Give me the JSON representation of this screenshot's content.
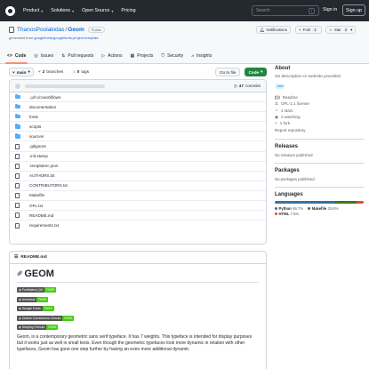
{
  "nav": {
    "items": [
      "Product",
      "Solutions",
      "Open Source",
      "Pricing"
    ],
    "search_placeholder": "Search",
    "search_key": "/",
    "signin": "Sign in",
    "signup": "Sign up"
  },
  "repo": {
    "owner": "ThanosPoulakidas",
    "name": "Geom",
    "visibility": "Public",
    "generated_prefix": "generated from",
    "generated_link": "googlefonts/googlefonts-project-template",
    "notifications": "Notifications",
    "fork": "Fork",
    "fork_count": "1",
    "star": "Star",
    "star_count": "4"
  },
  "tabs": [
    "Code",
    "Issues",
    "Pull requests",
    "Actions",
    "Projects",
    "Security",
    "Insights"
  ],
  "toolbar": {
    "branch": "main",
    "branches_count": "2",
    "branches_label": "branches",
    "tags_count": "0",
    "tags_label": "tags",
    "go_to_file": "Go to file",
    "code": "Code",
    "commits_count": "47",
    "commits_label": "commits"
  },
  "files": [
    {
      "name": ".github/workflows",
      "type": "folder"
    },
    {
      "name": "documentation",
      "type": "folder"
    },
    {
      "name": "fonts",
      "type": "folder"
    },
    {
      "name": "scripts",
      "type": "folder"
    },
    {
      "name": "sources",
      "type": "folder"
    },
    {
      "name": ".gitignore",
      "type": "file"
    },
    {
      "name": ".init.stamp",
      "type": "file"
    },
    {
      "name": ".templaterc.json",
      "type": "file"
    },
    {
      "name": "AUTHORS.txt",
      "type": "file"
    },
    {
      "name": "CONTRIBUTORS.txt",
      "type": "file"
    },
    {
      "name": "Makefile",
      "type": "file"
    },
    {
      "name": "OFL.txt",
      "type": "file"
    },
    {
      "name": "README.md",
      "type": "file"
    },
    {
      "name": "requirements.txt",
      "type": "file"
    }
  ],
  "readme": {
    "filename": "README.md",
    "title": "GEOM",
    "badges": [
      {
        "label": "Fontbakery QA",
        "value": "PASS",
        "color": "#44cc11"
      },
      {
        "label": "Universal",
        "value": "PASS",
        "color": "#44cc11"
      },
      {
        "label": "Google Fonts",
        "value": "PASS",
        "color": "#44cc11"
      },
      {
        "label": "Outline Correctness Checks",
        "value": "PASS",
        "color": "#44cc11"
      },
      {
        "label": "Shaping Checks",
        "value": "PASS",
        "color": "#44cc11"
      }
    ],
    "paragraph": "Geom, is a contemporary geometric sans serif typeface. It has 7 weights. This typeface is intended for display purposes but it works just as well in small texts. Even though the geometric typefaces look more dynamic in relation with other typefaces, Geom has gone one step further by having an even more additional dynamic"
  },
  "about": {
    "title": "About",
    "description": "No description or website provided.",
    "topic": "font",
    "items": [
      "Readme",
      "OFL-1.1 license",
      "4 stars",
      "2 watching",
      "1 fork"
    ],
    "report": "Report repository"
  },
  "releases": {
    "title": "Releases",
    "note": "No releases published"
  },
  "packages": {
    "title": "Packages",
    "note": "No packages published"
  },
  "languages": {
    "title": "Languages",
    "list": [
      {
        "name": "Python",
        "pct": "66.7%",
        "color": "#3572A5",
        "value": 66.7
      },
      {
        "name": "Makefile",
        "pct": "25.6%",
        "color": "#427819",
        "value": 25.6
      },
      {
        "name": "HTML",
        "pct": "7.6%",
        "color": "#e34c26",
        "value": 7.6
      }
    ]
  }
}
